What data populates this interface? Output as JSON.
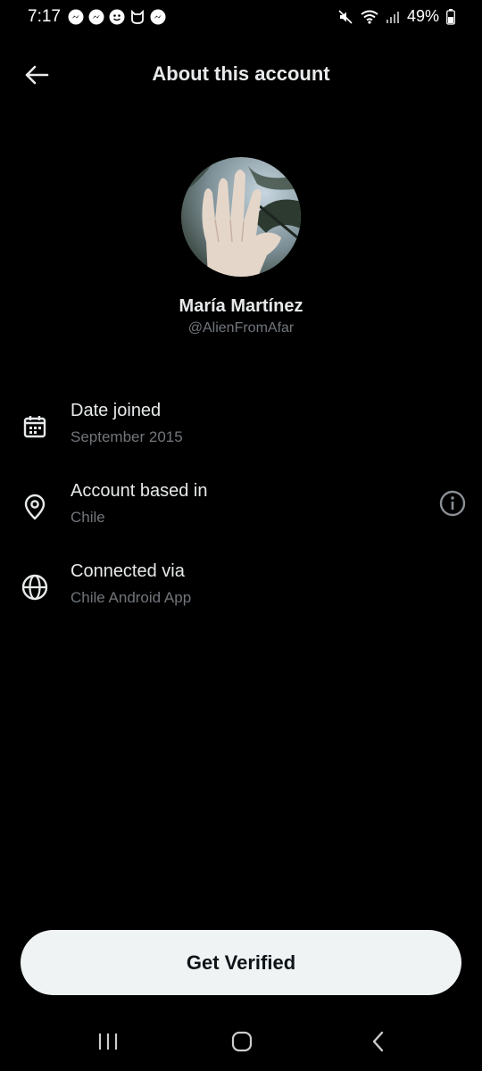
{
  "status_bar": {
    "time": "7:17",
    "battery": "49%",
    "notification_icons": [
      "messenger-icon",
      "messenger-icon",
      "face-app-icon",
      "cat-app-icon",
      "messenger-icon"
    ]
  },
  "header": {
    "title": "About this account"
  },
  "profile": {
    "name": "María Martínez",
    "handle": "@AlienFromAfar"
  },
  "info_rows": [
    {
      "icon": "calendar-icon",
      "label": "Date joined",
      "value": "September 2015"
    },
    {
      "icon": "location-pin-icon",
      "label": "Account based in",
      "value": "Chile"
    },
    {
      "icon": "globe-icon",
      "label": "Connected via",
      "value": "Chile Android App"
    }
  ],
  "cta": {
    "label": "Get Verified"
  },
  "colors": {
    "background": "#000000",
    "primary_text": "#e7e9ea",
    "secondary_text": "#71767b",
    "button_bg": "#eff3f4",
    "button_text": "#0f1419"
  }
}
